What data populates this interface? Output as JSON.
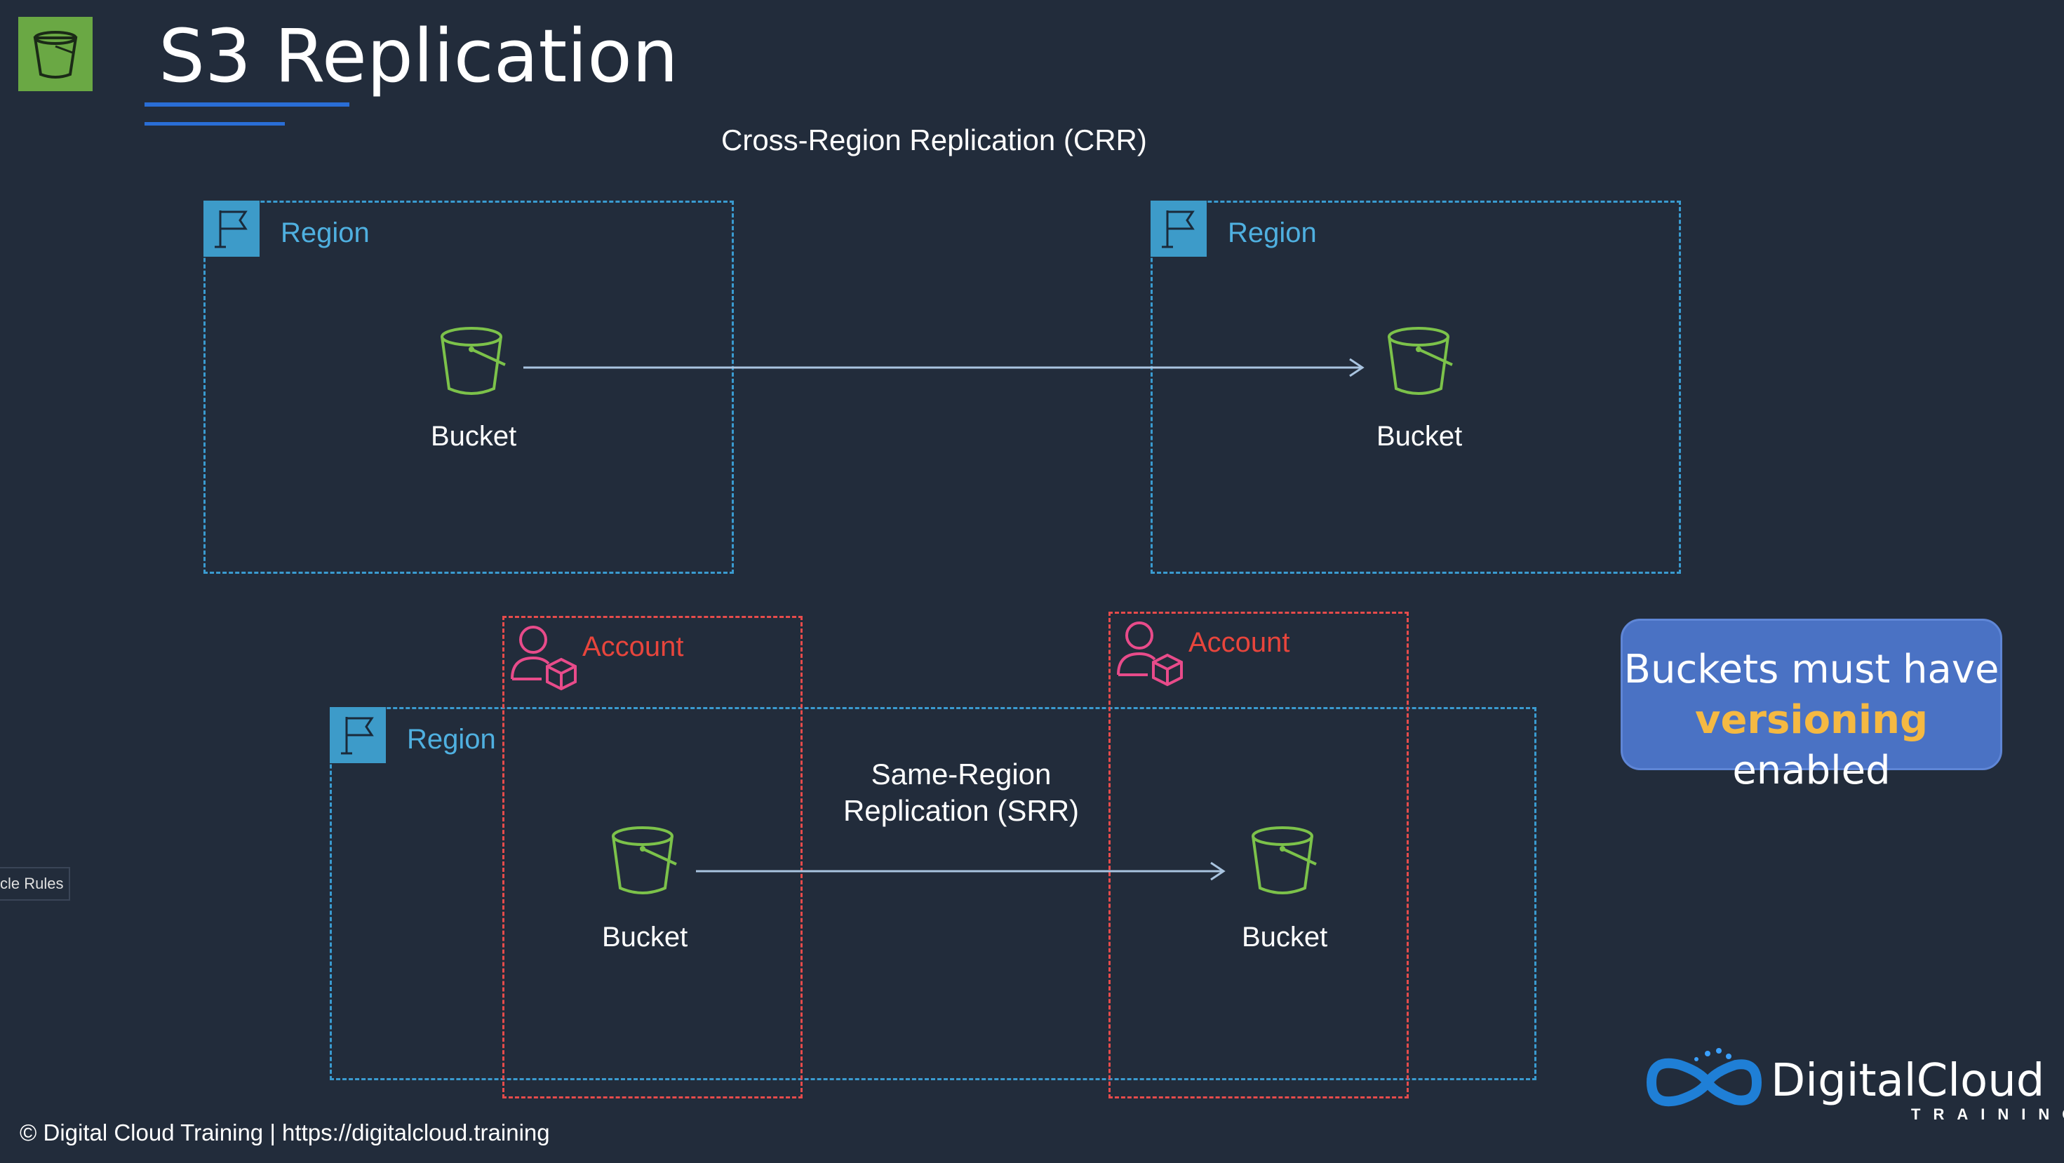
{
  "title": "S3 Replication",
  "crr_title": "Cross-Region Replication (CRR)",
  "region_label": "Region",
  "account_label": "Account",
  "bucket_label": "Bucket",
  "srr_line1": "Same-Region",
  "srr_line2": "Replication (SRR)",
  "note": {
    "before": "Buckets must have",
    "highlight": "versioning",
    "after": " enabled"
  },
  "footer": "© Digital Cloud Training  | https://digitalcloud.training",
  "side_tab": "cle Rules",
  "brand": {
    "name": "DigitalCloud",
    "sub": "TRAINING"
  },
  "colors": {
    "background": "#222c3b",
    "region": "#3a9bd0",
    "account": "#e64b4b",
    "bucket": "#7cc24a",
    "highlight": "#f5b942"
  }
}
